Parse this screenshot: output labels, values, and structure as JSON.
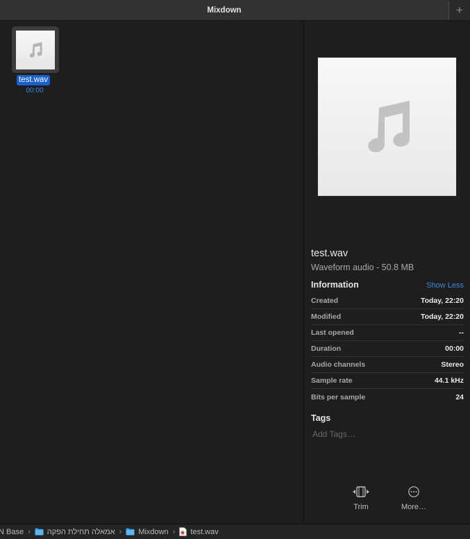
{
  "window": {
    "tab_title": "Mixdown",
    "new_tab_label": "+"
  },
  "file_item": {
    "name": "test.wav",
    "duration": "00:00",
    "icon": "music-note-icon"
  },
  "preview": {
    "title": "test.wav",
    "subtitle": "Waveform audio - 50.8 MB",
    "information_label": "Information",
    "show_less_label": "Show Less",
    "info": [
      {
        "label": "Created",
        "value": "Today, 22:20"
      },
      {
        "label": "Modified",
        "value": "Today, 22:20"
      },
      {
        "label": "Last opened",
        "value": "--"
      },
      {
        "label": "Duration",
        "value": "00:00"
      },
      {
        "label": "Audio channels",
        "value": "Stereo"
      },
      {
        "label": "Sample rate",
        "value": "44.1 kHz"
      },
      {
        "label": "Bits per sample",
        "value": "24"
      }
    ],
    "tags_label": "Tags",
    "tags_placeholder": "Add Tags…",
    "actions": {
      "trim": "Trim",
      "more": "More…"
    }
  },
  "path": {
    "separator": "›",
    "items": [
      {
        "label": "N Base",
        "icon": null
      },
      {
        "label": "אמאלה תחילת הפקה",
        "icon": "folder-icon"
      },
      {
        "label": "Mixdown",
        "icon": "folder-icon"
      },
      {
        "label": "test.wav",
        "icon": "audio-file-icon"
      }
    ]
  },
  "colors": {
    "accent": "#3f86e8",
    "selection": "#1a5fd1",
    "background": "#1e1e1e"
  }
}
